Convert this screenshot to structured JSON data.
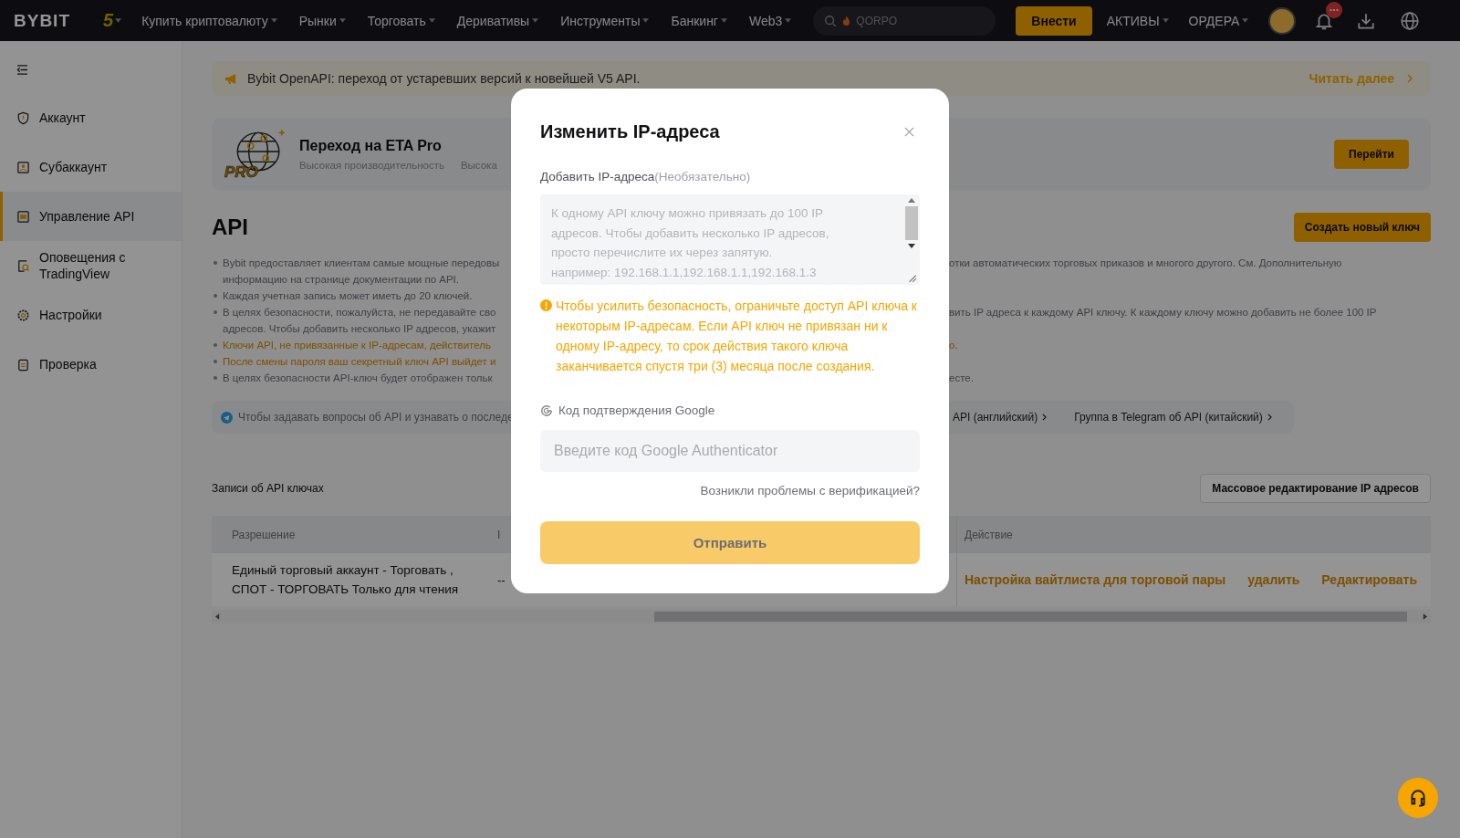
{
  "nav": {
    "logo": "BYBIT",
    "anniversary": "5",
    "menu": [
      {
        "label": "Купить криптовалюту",
        "dropdown": true
      },
      {
        "label": "Рынки",
        "dropdown": true
      },
      {
        "label": "Торговать",
        "dropdown": true
      },
      {
        "label": "Деривативы",
        "dropdown": true
      },
      {
        "label": "Инструменты",
        "dropdown": true
      },
      {
        "label": "Банкинг",
        "dropdown": true
      },
      {
        "label": "Web3",
        "dropdown": true
      }
    ],
    "search": {
      "placeholder": "QORPO"
    },
    "deposit_button": "Внести",
    "account_menu": [
      {
        "label": "АКТИВЫ",
        "dropdown": true
      },
      {
        "label": "ОРДЕРА",
        "dropdown": true
      }
    ],
    "notifications": {
      "unread": true
    }
  },
  "sidebar": {
    "items": [
      {
        "label": "Аккаунт",
        "kind": "shield",
        "selected": false
      },
      {
        "label": "Субаккаунт",
        "kind": "user",
        "selected": false
      },
      {
        "label": "Управление API",
        "kind": "api",
        "selected": true
      },
      {
        "label": "Оповещения с TradingView",
        "kind": "alert",
        "selected": false
      },
      {
        "label": "Настройки",
        "kind": "gear",
        "selected": false
      },
      {
        "label": "Проверка",
        "kind": "clipboard",
        "selected": false
      }
    ]
  },
  "announcement": {
    "text": "Bybit OpenAPI: переход от устаревших версий к новейшей V5 API.",
    "link": "Читать далее"
  },
  "promo": {
    "logo_text": "PRO",
    "title": "Переход на ETA Pro",
    "features": [
      "Высокая производительность",
      "Высока"
    ],
    "button": "Перейти"
  },
  "api": {
    "title": "API",
    "create_button": "Создать новый ключ",
    "notes": [
      {
        "warning": false,
        "lines": [
          {
            "left": "Bybit предоставляет клиентам самые мощные передовы",
            "right": "отки автоматических торговых приказов и многого другого. См. Дополнительную"
          },
          {
            "left": "информацию на странице документации по API."
          }
        ]
      },
      {
        "warning": false,
        "lines": [
          {
            "left": "Каждая учетная запись может иметь до 20 ключей."
          }
        ]
      },
      {
        "warning": false,
        "lines": [
          {
            "left": "В целях безопасности, пожалуйста, не передавайте сво",
            "right": "вить IP адреса к каждому API ключу. К каждому ключу можно добавить не более 100 IP"
          },
          {
            "left": "адресов. Чтобы добавить несколько IP адресов, укажит"
          }
        ]
      },
      {
        "warning": true,
        "lines": [
          {
            "left": "Ключи API, не привязанные к IP-адресам, действитель",
            "right": "о."
          }
        ]
      },
      {
        "warning": true,
        "lines": [
          {
            "left": "После смены пароля ваш секретный ключ API выйдет и"
          }
        ]
      },
      {
        "warning": false,
        "lines": [
          {
            "left": "В целях безопасности API-ключ будет отображен тольк",
            "right": "есте."
          }
        ]
      }
    ],
    "community": {
      "text": "Чтобы задавать вопросы об API и узнавать о последе",
      "links": [
        "API (английский)",
        "Группа в Telegram об API (китайский)"
      ]
    }
  },
  "records": {
    "title": "Записи об API ключах",
    "bulk_button": "Массовое редактирование IP адресов",
    "table": {
      "columns": [
        "Разрешение",
        "I",
        "Действие"
      ],
      "rows": [
        {
          "permission": "Единый торговый аккаунт - Торговать , СПОТ - ТОРГОВАТЬ Только для чтения",
          "column_2": "--",
          "actions": [
            "Настройка вайтлиста для торговой пары",
            "удалить",
            "Редактировать"
          ]
        }
      ]
    }
  },
  "modal": {
    "title": "Изменить IP-адреса",
    "ip_field": {
      "label": "Добавить IP-адреса",
      "hint": "(Необязательно)",
      "placeholder": "К одному API ключу можно привязать до 100 IP адресов. Чтобы добавить несколько IP адресов, просто перечислите их через запятую.\nнапример: 192.168.1.1,192.168.1.1,192.168.1.3"
    },
    "warning": "Чтобы усилить безопасность, ограничьте доступ API ключа к некоторым IP-адресам. Если API ключ не привязан ни к одному IP-адресу, то срок действия такого ключа заканчивается спустя три (3) месяца после создания.",
    "code_field": {
      "label": "Код подтверждения Google",
      "placeholder": "Введите код Google Authenticator"
    },
    "help_link": "Возникли проблемы с верификацией?",
    "submit_button": {
      "label": "Отправить",
      "disabled": true
    }
  }
}
